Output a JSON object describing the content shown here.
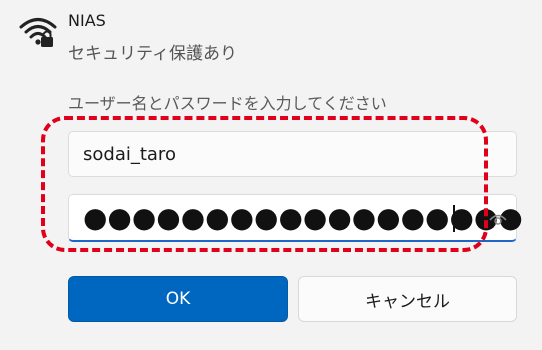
{
  "network": {
    "name": "NIAS",
    "status": "セキュリティ保護あり",
    "icon": "wifi-lock-icon"
  },
  "credentials": {
    "prompt": "ユーザー名とパスワードを入力してください",
    "username_value": "sodai_taro",
    "password_mask": "●●●●●●●●●●●●●●●●●●",
    "reveal_icon": "eye-icon"
  },
  "buttons": {
    "ok_label": "OK",
    "cancel_label": "キャンセル"
  },
  "colors": {
    "accent": "#0067c0",
    "highlight": "#e1001a",
    "background": "#f3f3f3"
  }
}
